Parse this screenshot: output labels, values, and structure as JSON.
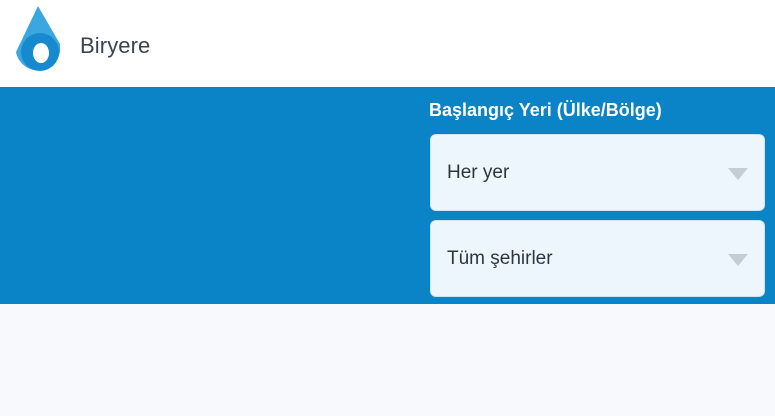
{
  "header": {
    "brand": "Biryere",
    "logo_icon": "water-drop-logo-icon"
  },
  "search": {
    "label": "Başlangıç Yeri (Ülke/Bölge)",
    "country_select": {
      "value": "Her yer",
      "icon": "chevron-down-icon"
    },
    "city_select": {
      "value": "Tüm şehirler",
      "icon": "chevron-down-icon"
    }
  },
  "colors": {
    "banner": "#0a84c6",
    "logo_light": "#3aa7e0",
    "logo_dark": "#1689cf",
    "select_bg": "#eef6fd",
    "brand_text": "#3a4352"
  }
}
